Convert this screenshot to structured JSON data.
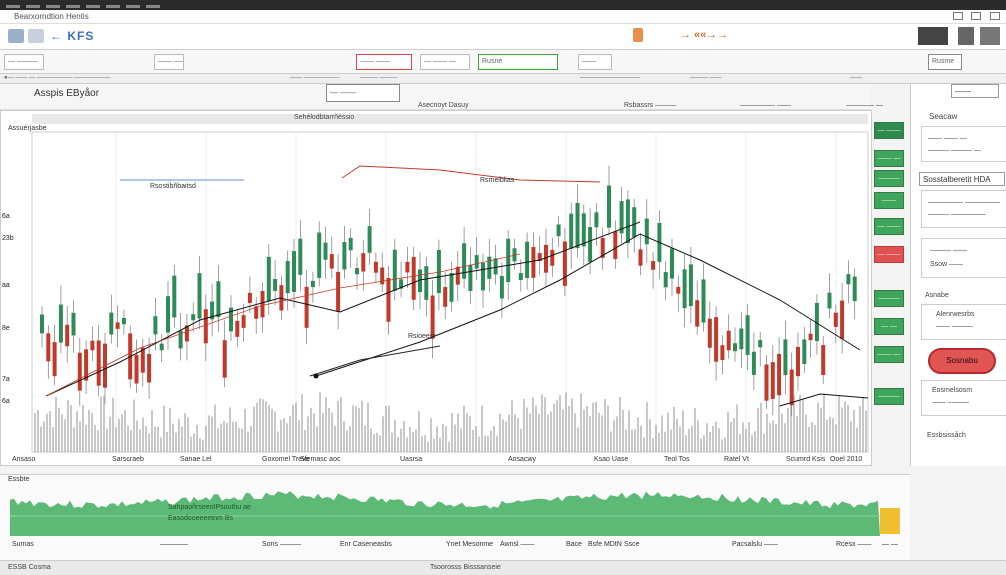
{
  "window": {
    "title": "Bearxorndtion Hentis"
  },
  "toolbar": {
    "app_label": "← KFS",
    "center_label": "→ ««→→",
    "right_label": "—"
  },
  "toolbar2": {
    "buttons": [
      "— ———",
      "—— ————",
      "—— ——",
      "— —— —",
      "Rusne",
      "——"
    ],
    "right_label": "Rusme"
  },
  "tabstrip": [
    "●— —— — —————— ——————",
    "—— ——————",
    "——— ———",
    "——————————",
    "——— ——",
    "——"
  ],
  "chart_header": {
    "symbol": "Asspis  EByåor",
    "box_label": "— ——",
    "labels": [
      "Asecnoyt  Dasuy",
      "Rsbassrs ———",
      "————— ——",
      "———— —"
    ],
    "right_box": "————"
  },
  "chart": {
    "title": "Sehélodbtarrñéssio",
    "left_label": "Assuérjasbe",
    "annotations": {
      "top_left": "Rsostibñbaitsd",
      "center": "Rsmeiblias",
      "mid": "Rsioeesr"
    },
    "y_labels": [
      "6a",
      "23b",
      "aa",
      "8e",
      "7a",
      "6a"
    ]
  },
  "x_labels": [
    "Ansaso",
    "Sarscraeb",
    "Sanae Lel",
    "Goxomel  Treve",
    "Sfemasc  aoc",
    "Uasrsa",
    "Aosacwy",
    "Ksao  Uase",
    "Teol  Tos",
    "Ratel  Vt",
    "Scumrd Ksis",
    "Ooel  2010"
  ],
  "side_buttons": [
    "— ——",
    "—— —",
    "———",
    "——",
    "— ——",
    "— ——",
    "———",
    "— —",
    "—— —",
    "———"
  ],
  "right_panel": {
    "top_box": "——",
    "heading": "Seacaw",
    "card1": [
      "—— —— —",
      "——— ——— —"
    ],
    "header2": "Sosstalberetit  HDA",
    "card2": [
      "————— —————",
      "——— —————"
    ],
    "card3": [
      "——— ——",
      "Ssow  ——"
    ],
    "label4": "Asnabe",
    "card4": [
      "Alenrwesrbs",
      "—— ———"
    ],
    "pill": "Sosnabu",
    "card5": [
      "Eosmelsosm",
      "—— ———"
    ],
    "footer": "Essbsissåch"
  },
  "indicator": {
    "label": "Essbte",
    "overlay_line1": "SahpaoñrseeoIPsuuthu  ae",
    "overlay_line2": "Easodooeeeetnm  Bs"
  },
  "bottom_axis": [
    "Sumas",
    "————",
    "Sons  ———",
    "Enr Caseneasbs",
    "Ynet  Mesonme",
    "Awnsl  ——",
    "Bace",
    "Bsfe  MDtN",
    "Ssce",
    "Pacsalslu  ——",
    "Rcesx  ——",
    "— —"
  ],
  "statusbar": {
    "left": "ESSB Cosma",
    "center": "Tsoorosss  Bisssanseie"
  },
  "colors": {
    "bull": "#2e8b57",
    "bear": "#c0392b",
    "accent_green": "#3fa45c",
    "accent_red": "#e05151"
  }
}
